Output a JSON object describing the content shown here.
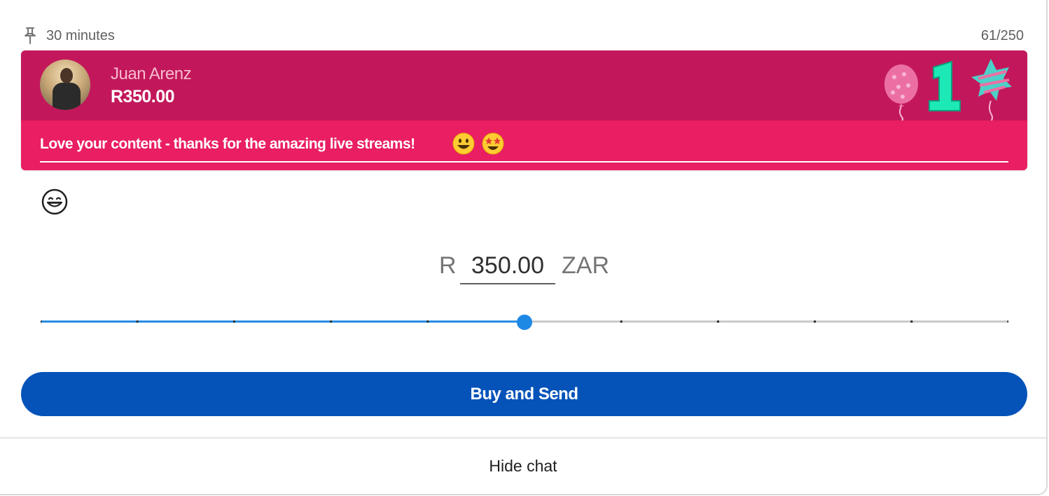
{
  "meta": {
    "duration": "30 minutes",
    "char_count": "61/250"
  },
  "superchat": {
    "author": "Juan Arenz",
    "amount": "R350.00",
    "message": "Love your content - thanks for the amazing live streams!",
    "header_color": "#c2185b",
    "body_color": "#e91e63",
    "author_color": "#f8bbd0",
    "message_emojis": [
      "grinning-face-emoji",
      "star-struck-emoji"
    ],
    "decoration": "balloons-number-one"
  },
  "amount_input": {
    "prefix": "R",
    "value": "350.00",
    "suffix": "ZAR"
  },
  "slider": {
    "value_fraction": 0.5,
    "ticks": 10,
    "active_color": "#1e88e5",
    "inactive_color": "#c8c8c8"
  },
  "buy_button": {
    "label": "Buy and Send",
    "color": "#0553b9"
  },
  "footer": {
    "hide_chat_label": "Hide chat"
  },
  "icons": {
    "pin": "pin-icon",
    "emoji_picker": "smiley-icon"
  }
}
